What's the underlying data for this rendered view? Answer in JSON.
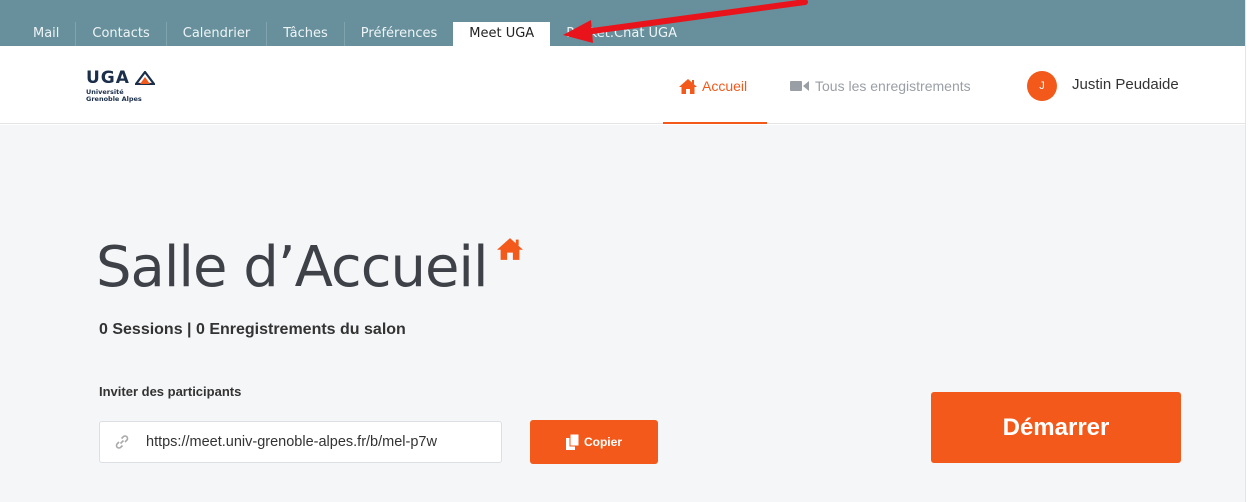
{
  "tabs": [
    {
      "label": "Mail"
    },
    {
      "label": "Contacts"
    },
    {
      "label": "Calendrier"
    },
    {
      "label": "Tâches"
    },
    {
      "label": "Préférences"
    },
    {
      "label": "Meet UGA",
      "active": true
    },
    {
      "label": "Rocket.Chat UGA"
    }
  ],
  "header": {
    "logo_text": "UGA",
    "logo_sub_1": "Université",
    "logo_sub_2": "Grenoble Alpes",
    "nav_home": "Accueil",
    "nav_recordings": "Tous les enregistrements",
    "avatar_initial": "J",
    "user_name": "Justin Peudaide"
  },
  "main": {
    "title": "Salle d’Accueil",
    "stats": "0 Sessions | 0 Enregistrements du salon",
    "invite_label": "Inviter des participants",
    "invite_url": "https://meet.univ-grenoble-alpes.fr/b/mel-p7w",
    "copy_label": "Copier",
    "start_label": "Démarrer"
  },
  "colors": {
    "accent": "#f2591b",
    "tabbar": "#68909c",
    "annotation": "#e8131b"
  },
  "icons": [
    "home-icon",
    "video-camera-icon",
    "link-icon",
    "copy-icon",
    "red-arrow-annotation"
  ]
}
